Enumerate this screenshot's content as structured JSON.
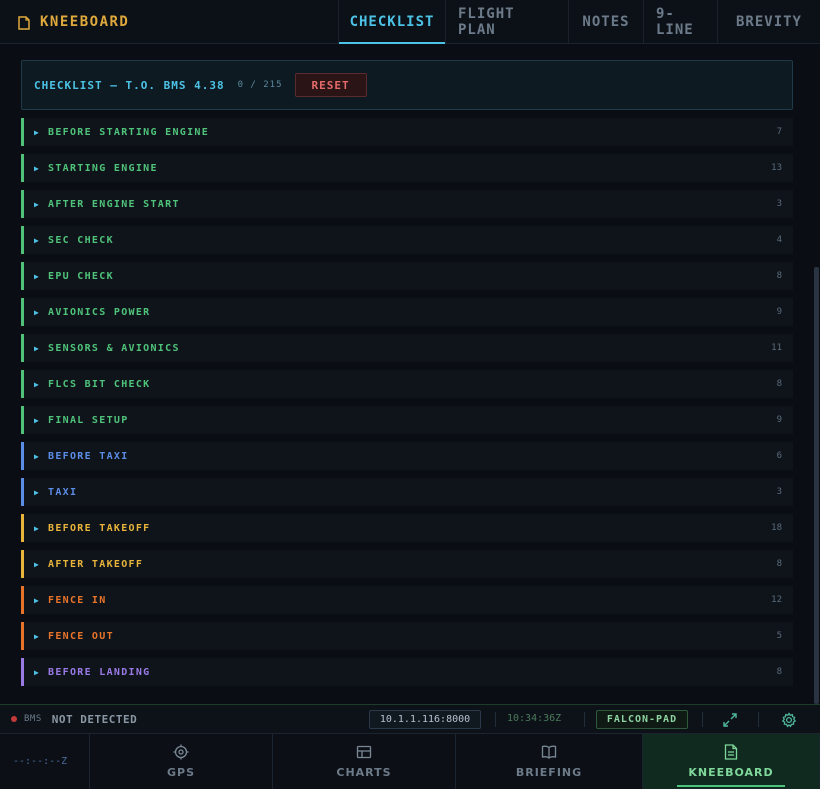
{
  "header": {
    "brand_icon": "document-icon",
    "brand_title": "KNEEBOARD",
    "tabs": [
      {
        "label": "CHECKLIST",
        "active": true
      },
      {
        "label": "FLIGHT PLAN",
        "active": false
      },
      {
        "label": "NOTES",
        "active": false
      },
      {
        "label": "9-LINE",
        "active": false
      },
      {
        "label": "BREVITY",
        "active": false
      }
    ]
  },
  "checklist": {
    "title": "CHECKLIST — T.O. BMS 4.38",
    "progress": "0 / 215",
    "reset_label": "RESET",
    "chevron": "▶",
    "sections": [
      {
        "name": "BEFORE STARTING ENGINE",
        "count": "7",
        "color": "#4fc37a"
      },
      {
        "name": "STARTING ENGINE",
        "count": "13",
        "color": "#4fc37a"
      },
      {
        "name": "AFTER ENGINE START",
        "count": "3",
        "color": "#4fc37a"
      },
      {
        "name": "SEC CHECK",
        "count": "4",
        "color": "#4fc37a"
      },
      {
        "name": "EPU CHECK",
        "count": "8",
        "color": "#4fc37a"
      },
      {
        "name": "AVIONICS POWER",
        "count": "9",
        "color": "#4fc37a"
      },
      {
        "name": "SENSORS & AVIONICS",
        "count": "11",
        "color": "#4fc37a"
      },
      {
        "name": "FLCS BIT CHECK",
        "count": "8",
        "color": "#4fc37a"
      },
      {
        "name": "FINAL SETUP",
        "count": "9",
        "color": "#4fc37a"
      },
      {
        "name": "BEFORE TAXI",
        "count": "6",
        "color": "#5b8de6"
      },
      {
        "name": "TAXI",
        "count": "3",
        "color": "#5b8de6"
      },
      {
        "name": "BEFORE TAKEOFF",
        "count": "18",
        "color": "#e8b43a"
      },
      {
        "name": "AFTER TAKEOFF",
        "count": "8",
        "color": "#e8b43a"
      },
      {
        "name": "FENCE IN",
        "count": "12",
        "color": "#e8742a"
      },
      {
        "name": "FENCE OUT",
        "count": "5",
        "color": "#e8742a"
      },
      {
        "name": "BEFORE LANDING",
        "count": "8",
        "color": "#9a7be6"
      }
    ]
  },
  "status": {
    "connection_dot_color": "#c43a3a",
    "bms_label": "BMS",
    "bms_state": "NOT DETECTED",
    "address": "10.1.1.116:8000",
    "clock": "10:34:36Z",
    "pad_label": "FALCON-PAD",
    "fullscreen_icon": "expand-icon",
    "settings_icon": "gear-icon"
  },
  "bottom_nav": {
    "zulu": "--:--:--Z",
    "items": [
      {
        "label": "GPS",
        "icon": "crosshair-icon",
        "active": false
      },
      {
        "label": "CHARTS",
        "icon": "map-icon",
        "active": false
      },
      {
        "label": "BRIEFING",
        "icon": "book-icon",
        "active": false
      },
      {
        "label": "KNEEBOARD",
        "icon": "document-icon",
        "active": true
      }
    ]
  }
}
